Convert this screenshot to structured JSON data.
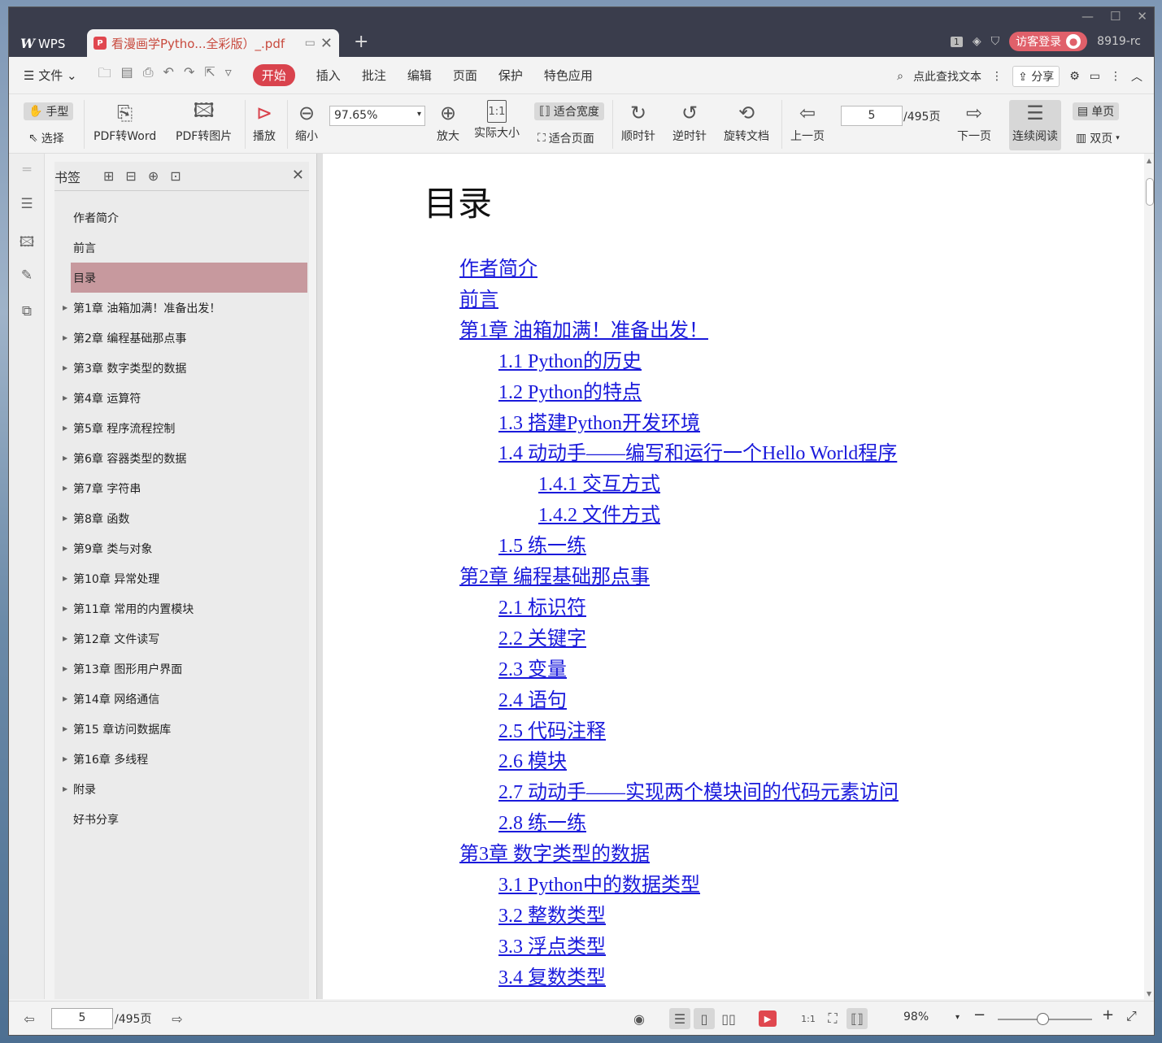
{
  "titlebar": {
    "app_tab": "WPS",
    "doc_tab": "看漫画学Pytho...全彩版）_.pdf",
    "page_badge": "1",
    "guest_login": "访客登录",
    "user_id": "8919-rc"
  },
  "menu": {
    "file": "文件",
    "items": [
      "开始",
      "插入",
      "批注",
      "编辑",
      "页面",
      "保护",
      "特色应用"
    ],
    "search": "点此查找文本",
    "share": "分享"
  },
  "ribbon": {
    "hand": "手型",
    "select": "选择",
    "pdf_to_word": "PDF转Word",
    "pdf_to_image": "PDF转图片",
    "play": "播放",
    "zoom_out": "缩小",
    "zoom_value": "97.65%",
    "zoom_in": "放大",
    "actual_size": "实际大小",
    "fit_width": "适合宽度",
    "fit_page": "适合页面",
    "clockwise": "顺时针",
    "counterclockwise": "逆时针",
    "rotate_doc": "旋转文档",
    "prev_page": "上一页",
    "page_value": "5",
    "page_total": "/495页",
    "next_page": "下一页",
    "continuous": "连续阅读",
    "single_page": "单页",
    "double_page": "双页"
  },
  "bookmarks": {
    "title": "书签",
    "items": [
      {
        "label": "作者简介",
        "expandable": false,
        "selected": false
      },
      {
        "label": "前言",
        "expandable": false,
        "selected": false
      },
      {
        "label": "目录",
        "expandable": false,
        "selected": true
      },
      {
        "label": "第1章 油箱加满！准备出发！",
        "expandable": true,
        "selected": false
      },
      {
        "label": "第2章 编程基础那点事",
        "expandable": true,
        "selected": false
      },
      {
        "label": "第3章 数字类型的数据",
        "expandable": true,
        "selected": false
      },
      {
        "label": "第4章 运算符",
        "expandable": true,
        "selected": false
      },
      {
        "label": "第5章 程序流程控制",
        "expandable": true,
        "selected": false
      },
      {
        "label": "第6章 容器类型的数据",
        "expandable": true,
        "selected": false
      },
      {
        "label": "第7章 字符串",
        "expandable": true,
        "selected": false
      },
      {
        "label": "第8章 函数",
        "expandable": true,
        "selected": false
      },
      {
        "label": "第9章 类与对象",
        "expandable": true,
        "selected": false
      },
      {
        "label": "第10章 异常处理",
        "expandable": true,
        "selected": false
      },
      {
        "label": "第11章 常用的内置模块",
        "expandable": true,
        "selected": false
      },
      {
        "label": "第12章 文件读写",
        "expandable": true,
        "selected": false
      },
      {
        "label": "第13章 图形用户界面",
        "expandable": true,
        "selected": false
      },
      {
        "label": "第14章 网络通信",
        "expandable": true,
        "selected": false
      },
      {
        "label": "第15 章访问数据库",
        "expandable": true,
        "selected": false
      },
      {
        "label": "第16章 多线程",
        "expandable": true,
        "selected": false
      },
      {
        "label": "附录",
        "expandable": true,
        "selected": false
      },
      {
        "label": "好书分享",
        "expandable": false,
        "selected": false
      }
    ]
  },
  "document": {
    "heading": "目录",
    "toc": [
      {
        "text": "作者简介",
        "level": 0
      },
      {
        "text": "前言",
        "level": 0
      },
      {
        "text": "第1章 油箱加满！准备出发！",
        "level": 0
      },
      {
        "text": "1.1 Python的历史",
        "level": 1
      },
      {
        "text": "1.2 Python的特点",
        "level": 1
      },
      {
        "text": "1.3 搭建Python开发环境",
        "level": 1
      },
      {
        "text": "1.4 动动手——编写和运行一个Hello World程序",
        "level": 1
      },
      {
        "text": "1.4.1 交互方式",
        "level": 2
      },
      {
        "text": "1.4.2 文件方式",
        "level": 2
      },
      {
        "text": "1.5 练一练",
        "level": 1
      },
      {
        "text": "第2章 编程基础那点事",
        "level": 0
      },
      {
        "text": "2.1 标识符",
        "level": 1
      },
      {
        "text": "2.2 关键字",
        "level": 1
      },
      {
        "text": "2.3 变量",
        "level": 1
      },
      {
        "text": "2.4 语句",
        "level": 1
      },
      {
        "text": "2.5 代码注释",
        "level": 1
      },
      {
        "text": "2.6 模块",
        "level": 1
      },
      {
        "text": "2.7 动动手——实现两个模块间的代码元素访问",
        "level": 1
      },
      {
        "text": "2.8 练一练",
        "level": 1
      },
      {
        "text": "第3章 数字类型的数据",
        "level": 0
      },
      {
        "text": "3.1 Python中的数据类型",
        "level": 1
      },
      {
        "text": "3.2 整数类型",
        "level": 1
      },
      {
        "text": "3.3 浮点类型",
        "level": 1
      },
      {
        "text": "3.4 复数类型",
        "level": 1
      }
    ]
  },
  "status": {
    "page_value": "5",
    "page_total": "/495页",
    "zoom": "98%"
  }
}
